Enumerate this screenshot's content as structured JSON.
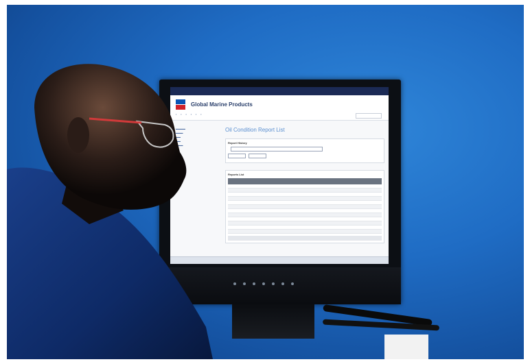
{
  "photo": {
    "background_color": "#1f6cc4",
    "subject": "person-in-silhouette-viewing-monitor"
  },
  "monitor": {
    "brand_color": "#6b7280"
  },
  "screen": {
    "site_title": "Global Marine Products",
    "page_title": "Oil Condition Report List",
    "report_history_heading": "Report History",
    "select_label": "",
    "selected_value": "",
    "reports_list_heading": "Reports List",
    "table": {
      "headers": [
        "",
        "",
        "",
        "",
        ""
      ],
      "row_count": 12
    },
    "logo_colors": {
      "top": "#0a55b5",
      "bottom": "#d0222a"
    }
  }
}
